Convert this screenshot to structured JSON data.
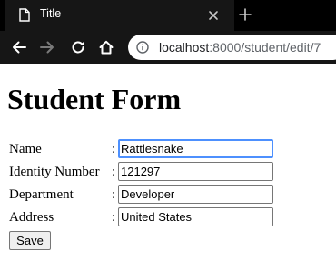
{
  "browser": {
    "tab": {
      "title": "Title",
      "favicon": "document-icon"
    },
    "icons": {
      "close_tab": "close-icon",
      "new_tab": "plus-icon",
      "back": "arrow-left-icon",
      "forward": "arrow-right-icon",
      "reload": "reload-icon",
      "home": "home-icon",
      "site_info": "info-icon"
    },
    "url": {
      "host": "localhost",
      "rest": ":8000/student/edit/7"
    }
  },
  "page": {
    "title": "Student Form",
    "colon": ":",
    "fields": [
      {
        "label": "Name",
        "value": "Rattlesnake"
      },
      {
        "label": "Identity Number",
        "value": "121297"
      },
      {
        "label": "Department",
        "value": "Developer"
      },
      {
        "label": "Address",
        "value": "United States"
      }
    ],
    "save_label": "Save"
  }
}
